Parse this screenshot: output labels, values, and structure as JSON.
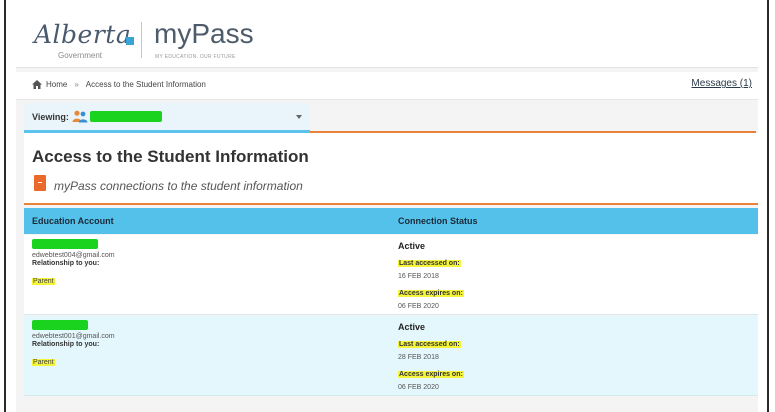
{
  "header": {
    "logo_alberta": "Alberta",
    "logo_government": "Government",
    "logo_mypass": "myPass",
    "logo_tagline": "MY EDUCATION. OUR FUTURE"
  },
  "breadcrumb": {
    "home": "Home",
    "separator": "»",
    "current": "Access to the Student Information"
  },
  "messages_link": "Messages (1)",
  "viewing": {
    "label": "Viewing:"
  },
  "page": {
    "title": "Access to the Student Information",
    "subtitle": "myPass connections to the student information"
  },
  "table": {
    "columns": [
      "Education Account",
      "Connection Status"
    ],
    "rows": [
      {
        "email": "edwebtest004@gmail.com",
        "relationship_label": "Relationship to you:",
        "relationship": "Parent",
        "status": "Active",
        "last_accessed_label": "Last accessed on:",
        "last_accessed": "16 FEB 2018",
        "expires_label": "Access expires on:",
        "expires": "06 FEB 2020"
      },
      {
        "email": "edwebtest001@gmail.com",
        "relationship_label": "Relationship to you:",
        "relationship": "Parent",
        "status": "Active",
        "last_accessed_label": "Last accessed on:",
        "last_accessed": "28 FEB 2018",
        "expires_label": "Access expires on:",
        "expires": "06 FEB 2020"
      }
    ]
  },
  "colors": {
    "table_header": "#54c1eb",
    "accent_orange": "#e8823a",
    "row_alt": "#e4f7fc",
    "highlight": "#f4f43a",
    "redaction": "#19d31f"
  }
}
